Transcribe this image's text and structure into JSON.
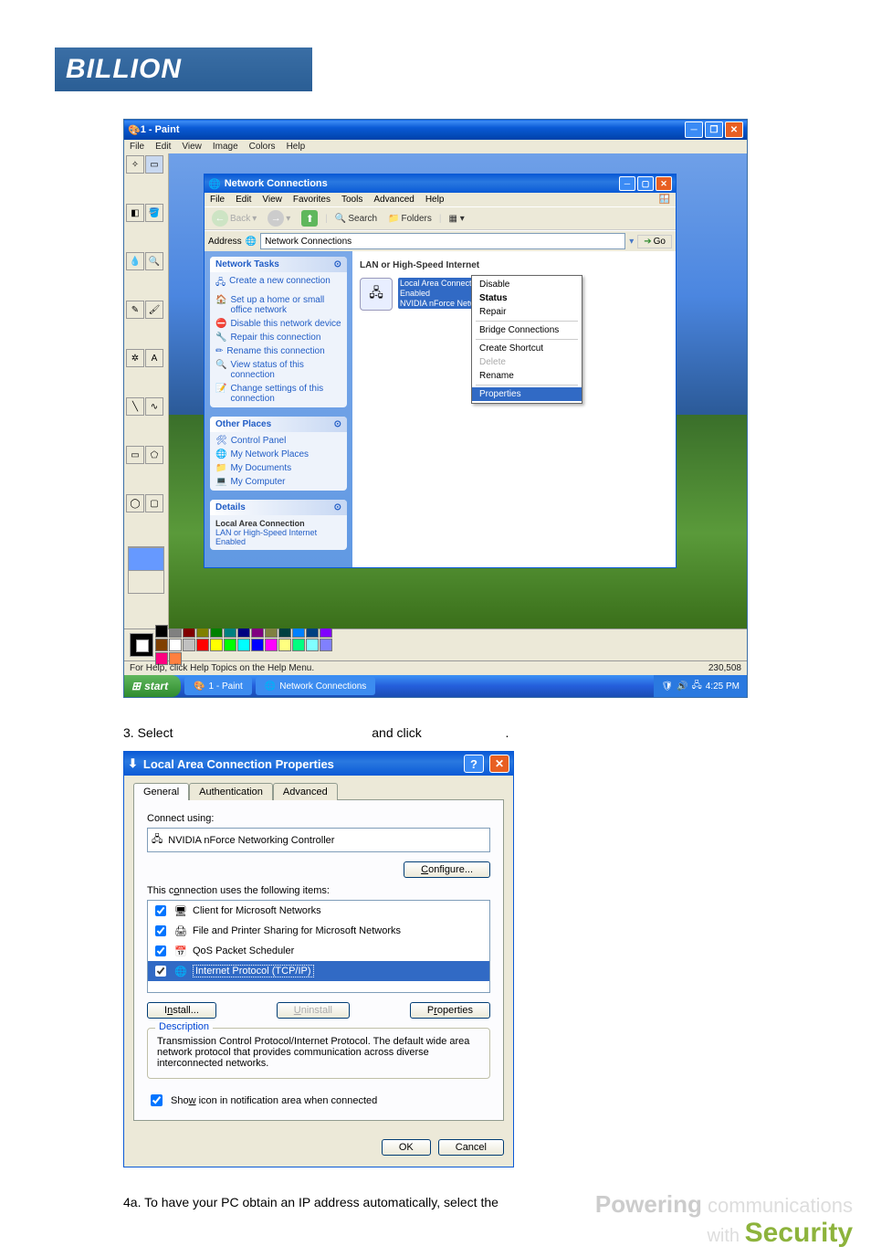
{
  "logo_text": "BILLION",
  "step3_prefix": "3. Select",
  "step3_mid": "and click",
  "step3_suffix": ".",
  "step4a": "4a. To have your PC obtain an IP address automatically, select the",
  "footer": {
    "powering": "Powering",
    "comm": " communications",
    "with": "with ",
    "sec": "Security"
  },
  "paint": {
    "title": "1 - Paint",
    "menu": [
      "File",
      "Edit",
      "View",
      "Image",
      "Colors",
      "Help"
    ],
    "status_left": "For Help, click Help Topics on the Help Menu.",
    "status_right": "230,508",
    "start": "start",
    "task1": "1 - Paint",
    "task2": "Network Connections",
    "clock": "4:25 PM"
  },
  "palette": [
    "#000",
    "#808080",
    "#800000",
    "#808000",
    "#008000",
    "#008080",
    "#000080",
    "#800080",
    "#808040",
    "#004040",
    "#0080ff",
    "#004080",
    "#8000ff",
    "#804000",
    "#fff",
    "#c0c0c0",
    "#f00",
    "#ff0",
    "#0f0",
    "#0ff",
    "#00f",
    "#f0f",
    "#ffff80",
    "#00ff80",
    "#80ffff",
    "#8080ff",
    "#ff0080",
    "#ff8040"
  ],
  "nc": {
    "title": "Network Connections",
    "flag": "🪟",
    "menu": [
      "File",
      "Edit",
      "View",
      "Favorites",
      "Tools",
      "Advanced",
      "Help"
    ],
    "back": "Back",
    "search": "Search",
    "folders": "Folders",
    "address_label": "Address",
    "address_value": "Network Connections",
    "go": "Go",
    "cat": "LAN or High-Speed Internet",
    "lac": {
      "name": "Local Area Connection",
      "state": "Enabled",
      "dev": "NVIDIA nForce Networ..."
    },
    "tasks_heading": "Network Tasks",
    "tasks": [
      "Create a new connection",
      "Set up a home or small office network",
      "Disable this network device",
      "Repair this connection",
      "Rename this connection",
      "View status of this connection",
      "Change settings of this connection"
    ],
    "places_heading": "Other Places",
    "places": [
      "Control Panel",
      "My Network Places",
      "My Documents",
      "My Computer"
    ],
    "details_heading": "Details",
    "details": {
      "name": "Local Area Connection",
      "type": "LAN or High-Speed Internet",
      "state": "Enabled"
    },
    "ctx": {
      "disable": "Disable",
      "status": "Status",
      "repair": "Repair",
      "bridge": "Bridge Connections",
      "shortcut": "Create Shortcut",
      "delete": "Delete",
      "rename": "Rename",
      "properties": "Properties"
    }
  },
  "props": {
    "title": "Local Area Connection Properties",
    "tabs": {
      "general": "General",
      "auth": "Authentication",
      "adv": "Advanced"
    },
    "connect_using": "Connect using:",
    "adapter": "NVIDIA nForce Networking Controller",
    "configure": "Configure...",
    "uses": "This connection uses the following items:",
    "items": {
      "client": "Client for Microsoft Networks",
      "fps": "File and Printer Sharing for Microsoft Networks",
      "qos": "QoS Packet Scheduler",
      "tcp": "Internet Protocol (TCP/IP)"
    },
    "install": "Install...",
    "uninstall": "Uninstall",
    "propbtn": "Properties",
    "desc_heading": "Description",
    "desc": "Transmission Control Protocol/Internet Protocol. The default wide area network protocol that provides communication across diverse interconnected networks.",
    "show_icon": "Show icon in notification area when connected",
    "ok": "OK",
    "cancel": "Cancel"
  }
}
